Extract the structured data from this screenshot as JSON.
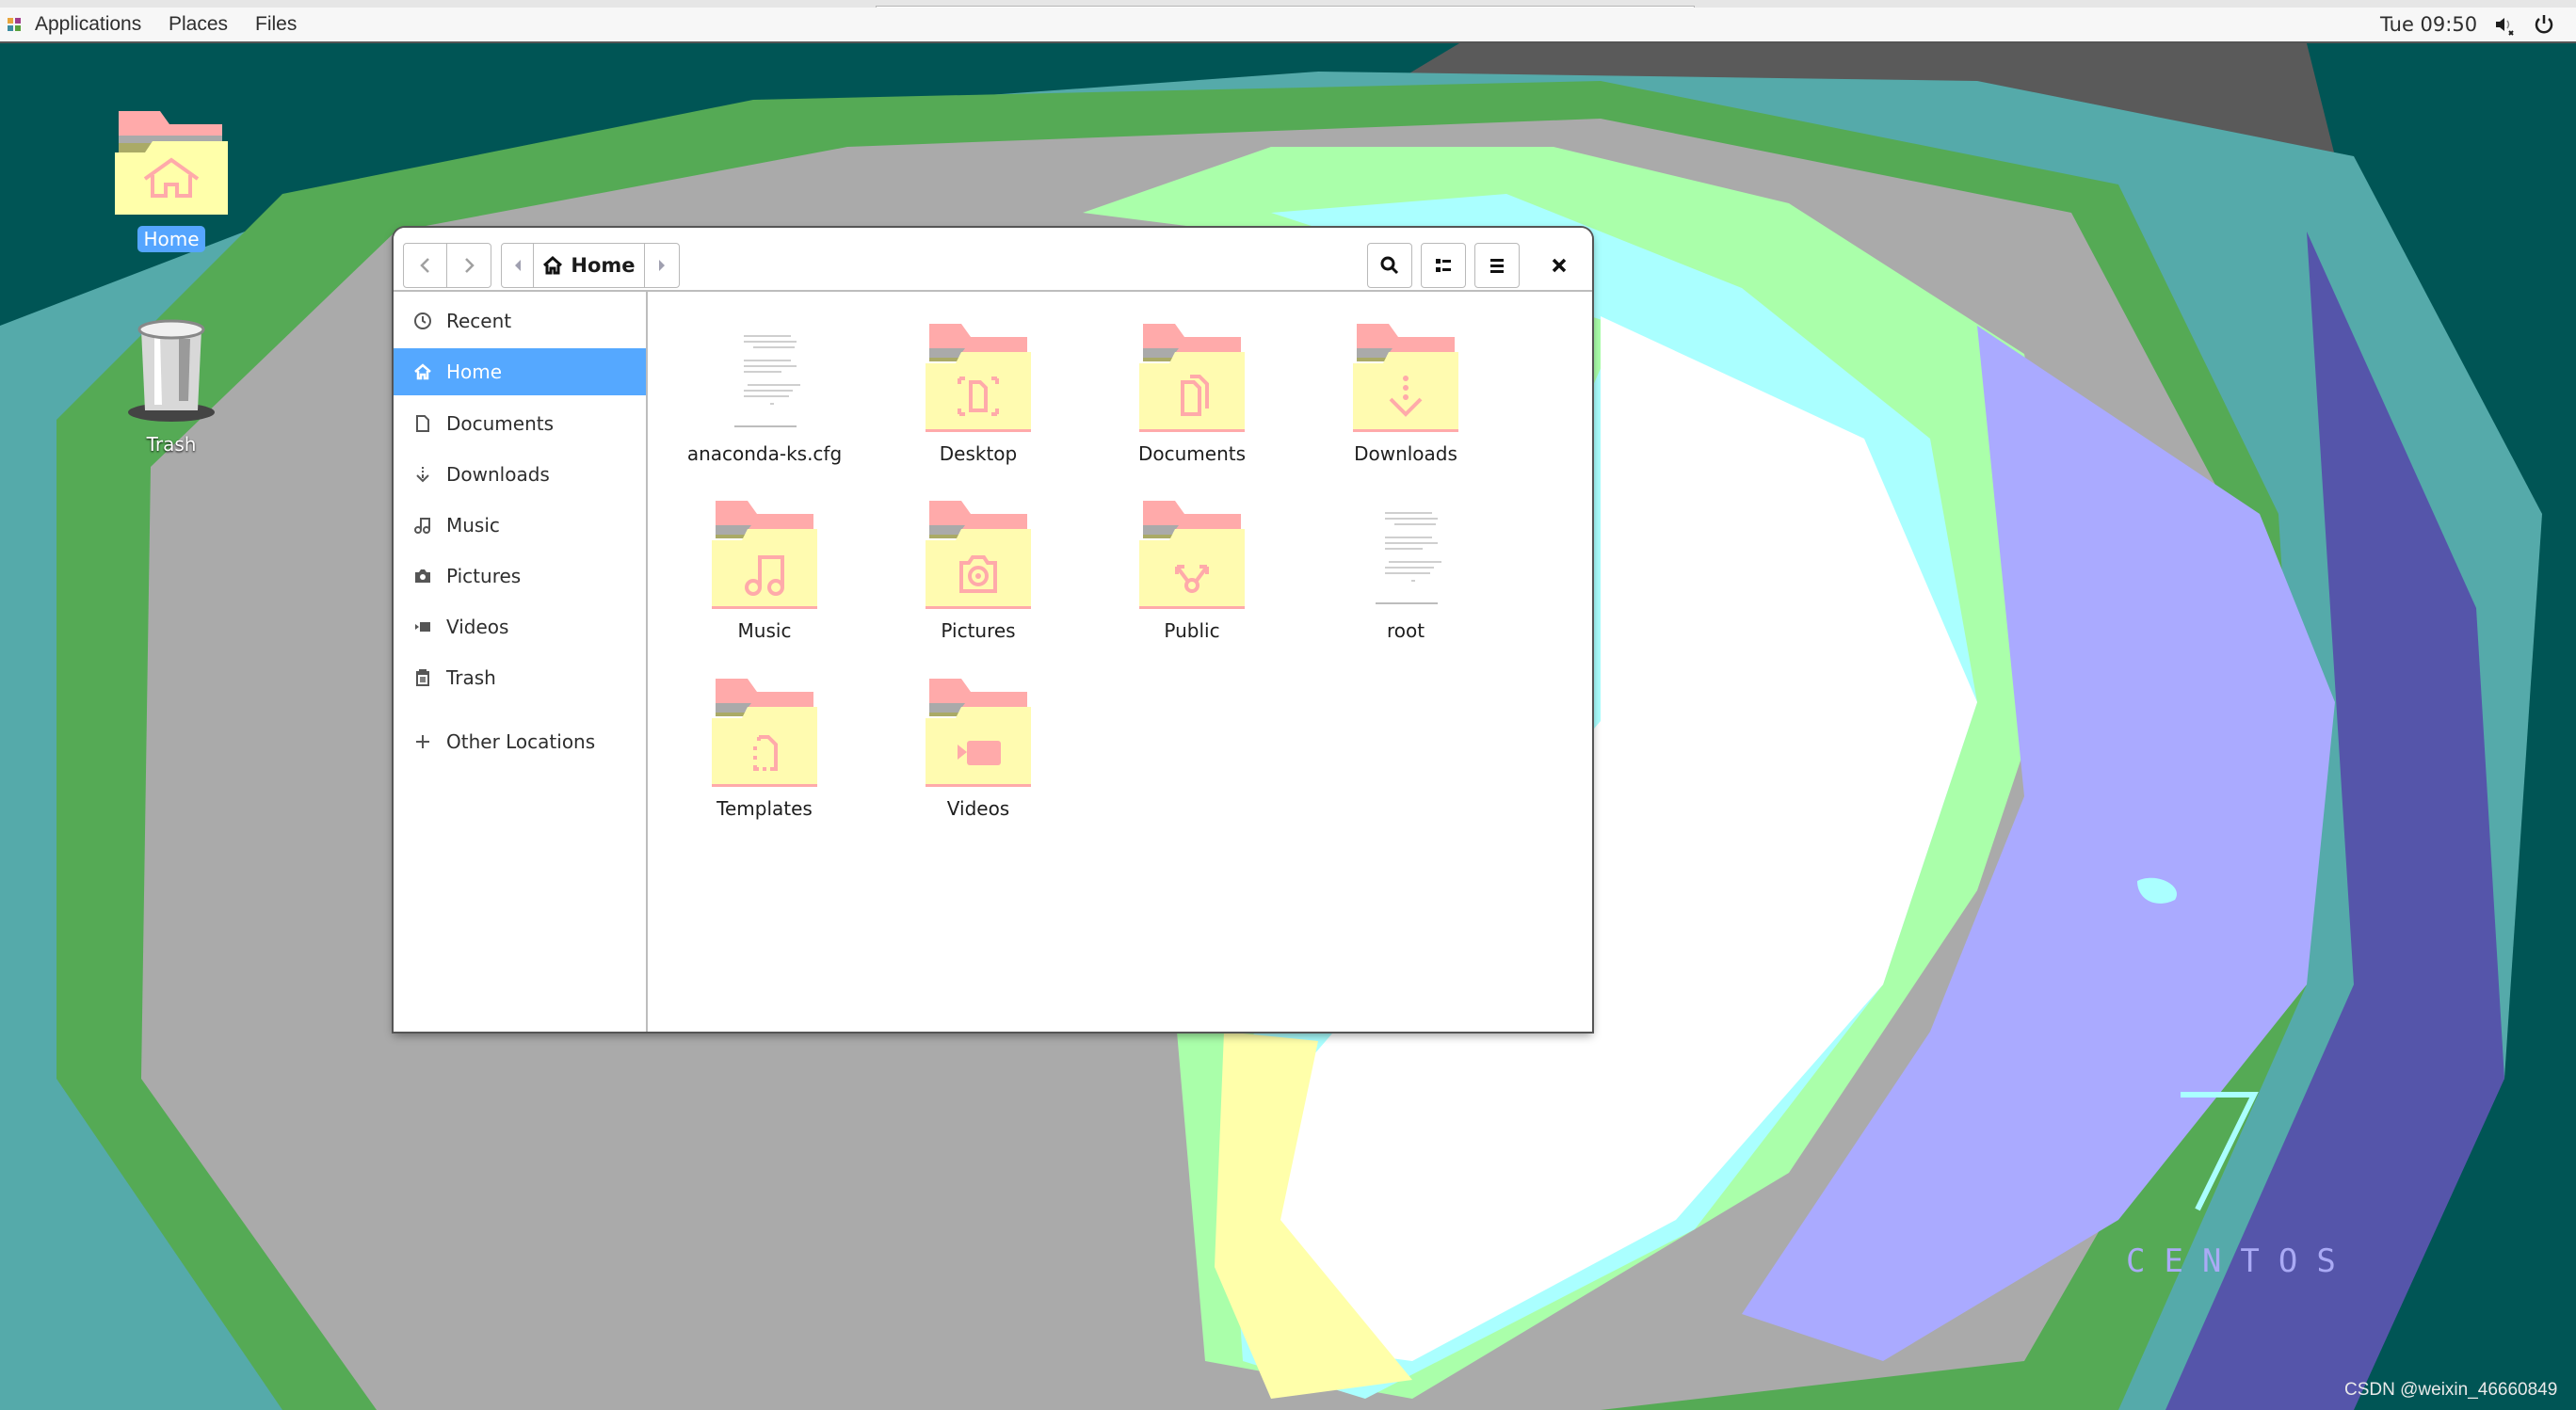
{
  "topbar": {
    "menus": [
      "Applications",
      "Places",
      "Files"
    ],
    "clock": "Tue 09:50",
    "tray_icons": [
      "volume-muted-icon",
      "power-icon"
    ]
  },
  "desktop": {
    "icons": [
      {
        "label": "Home",
        "icon": "home-folder-icon",
        "selected": true
      },
      {
        "label": "Trash",
        "icon": "trash-can-icon",
        "selected": false
      }
    ],
    "branding": {
      "number": "7",
      "name": "CENTOS"
    },
    "watermark": "CSDN @weixin_46660849"
  },
  "window": {
    "path": {
      "current": "Home",
      "icon": "home-icon"
    },
    "nav": {
      "back_icon": "chevron-left-icon",
      "forward_icon": "chevron-right-icon",
      "path_left_icon": "triangle-left-icon",
      "path_right_icon": "triangle-right-icon"
    },
    "toolbar": {
      "search_icon": "search-icon",
      "view_icon": "list-view-icon",
      "menu_icon": "hamburger-menu-icon",
      "close_icon": "close-icon"
    },
    "sidebar": {
      "items": [
        {
          "label": "Recent",
          "icon": "clock-icon",
          "active": false
        },
        {
          "label": "Home",
          "icon": "home-icon",
          "active": true
        },
        {
          "label": "Documents",
          "icon": "document-icon",
          "active": false
        },
        {
          "label": "Downloads",
          "icon": "download-icon",
          "active": false
        },
        {
          "label": "Music",
          "icon": "music-note-icon",
          "active": false
        },
        {
          "label": "Pictures",
          "icon": "camera-icon",
          "active": false
        },
        {
          "label": "Videos",
          "icon": "video-icon",
          "active": false
        },
        {
          "label": "Trash",
          "icon": "trash-icon",
          "active": false
        }
      ],
      "other_locations": {
        "label": "Other Locations",
        "icon": "plus-icon"
      }
    },
    "files": [
      {
        "name": "anaconda-ks.cfg",
        "type": "text-file"
      },
      {
        "name": "Desktop",
        "type": "folder",
        "emblem": "desktop"
      },
      {
        "name": "Documents",
        "type": "folder",
        "emblem": "documents"
      },
      {
        "name": "Downloads",
        "type": "folder",
        "emblem": "downloads"
      },
      {
        "name": "Music",
        "type": "folder",
        "emblem": "music"
      },
      {
        "name": "Pictures",
        "type": "folder",
        "emblem": "pictures"
      },
      {
        "name": "Public",
        "type": "folder",
        "emblem": "public"
      },
      {
        "name": "root",
        "type": "text-file"
      },
      {
        "name": "Templates",
        "type": "folder",
        "emblem": "templates"
      },
      {
        "name": "Videos",
        "type": "folder",
        "emblem": "videos"
      }
    ]
  },
  "colors": {
    "accent": "#55a8ff",
    "folder_body": "#fffbb0",
    "folder_tab": "#ffaaaa",
    "folder_emblem": "#ffaaaa"
  }
}
